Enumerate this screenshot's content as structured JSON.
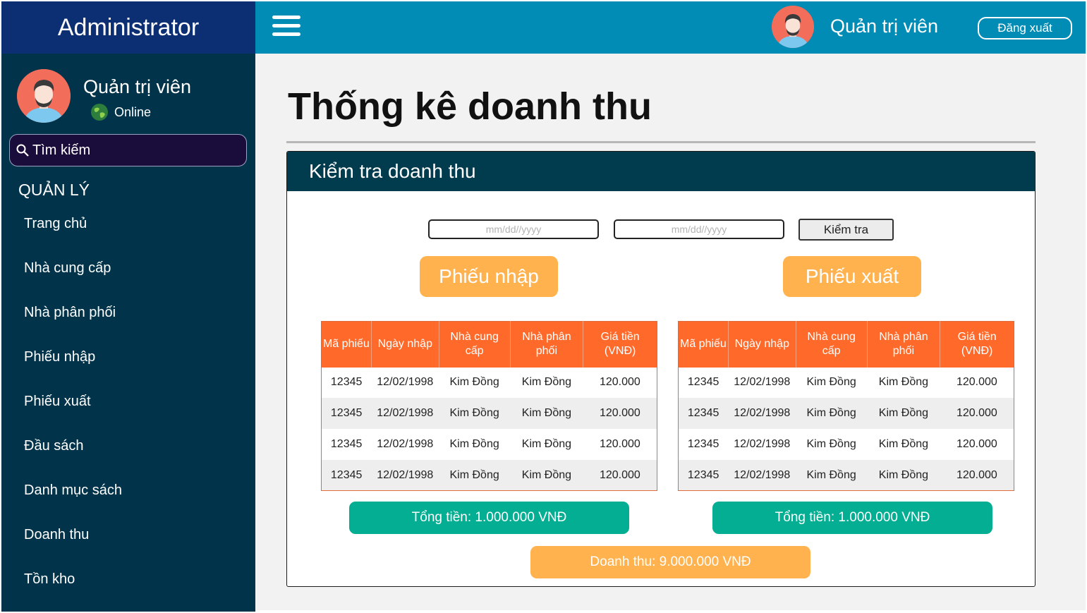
{
  "app": {
    "brand": "Administrator"
  },
  "topbar": {
    "user_name": "Quản trị viên",
    "logout_label": "Đăng xuất"
  },
  "sidebar": {
    "user_name": "Quản trị viên",
    "status": "Online",
    "search_label": "Tìm kiếm",
    "section": "QUẢN LÝ",
    "items": [
      {
        "label": "Trang chủ"
      },
      {
        "label": "Nhà cung cấp"
      },
      {
        "label": "Nhà phân phối"
      },
      {
        "label": "Phiếu nhập"
      },
      {
        "label": "Phiếu xuất"
      },
      {
        "label": "Đầu sách"
      },
      {
        "label": "Danh mục sách"
      },
      {
        "label": "Doanh thu"
      },
      {
        "label": "Tồn kho"
      }
    ]
  },
  "main": {
    "title": "Thống kê doanh thu",
    "card_title": "Kiểm tra doanh thu",
    "date_from_placeholder": "mm/dd//yyyy",
    "date_to_placeholder": "mm/dd//yyyy",
    "check_label": "Kiểm tra",
    "import": {
      "label": "Phiếu nhập",
      "headers": [
        "Mã phiếu",
        "Ngày nhập",
        "Nhà cung cấp",
        "Nhà phân phối",
        "Giá tiền (VNĐ)"
      ],
      "rows": [
        [
          "12345",
          "12/02/1998",
          "Kim Đồng",
          "Kim Đồng",
          "120.000"
        ],
        [
          "12345",
          "12/02/1998",
          "Kim Đồng",
          "Kim Đồng",
          "120.000"
        ],
        [
          "12345",
          "12/02/1998",
          "Kim Đồng",
          "Kim Đồng",
          "120.000"
        ],
        [
          "12345",
          "12/02/1998",
          "Kim Đồng",
          "Kim Đồng",
          "120.000"
        ]
      ],
      "total": "Tổng tiền: 1.000.000 VNĐ"
    },
    "export": {
      "label": "Phiếu xuất",
      "headers": [
        "Mã phiếu",
        "Ngày nhập",
        "Nhà cung cấp",
        "Nhà phân phối",
        "Giá tiền (VNĐ)"
      ],
      "rows": [
        [
          "12345",
          "12/02/1998",
          "Kim Đồng",
          "Kim Đồng",
          "120.000"
        ],
        [
          "12345",
          "12/02/1998",
          "Kim Đồng",
          "Kim Đồng",
          "120.000"
        ],
        [
          "12345",
          "12/02/1998",
          "Kim Đồng",
          "Kim Đồng",
          "120.000"
        ],
        [
          "12345",
          "12/02/1998",
          "Kim Đồng",
          "Kim Đồng",
          "120.000"
        ]
      ],
      "total": "Tổng tiền: 1.000.000 VNĐ"
    },
    "revenue": "Doanh thu: 9.000.000 VNĐ"
  },
  "icons": {
    "menu": "hamburger-menu-icon",
    "avatar": "user-avatar-icon",
    "status": "globe-icon",
    "search": "search-icon"
  },
  "colors": {
    "brand": "#0c2f73",
    "sidebar": "#01344a",
    "topbar": "#008cb4",
    "card_header": "#013b4e",
    "table_header": "#ff6a2a",
    "pill": "#ffb24e",
    "total": "#03ae92"
  }
}
